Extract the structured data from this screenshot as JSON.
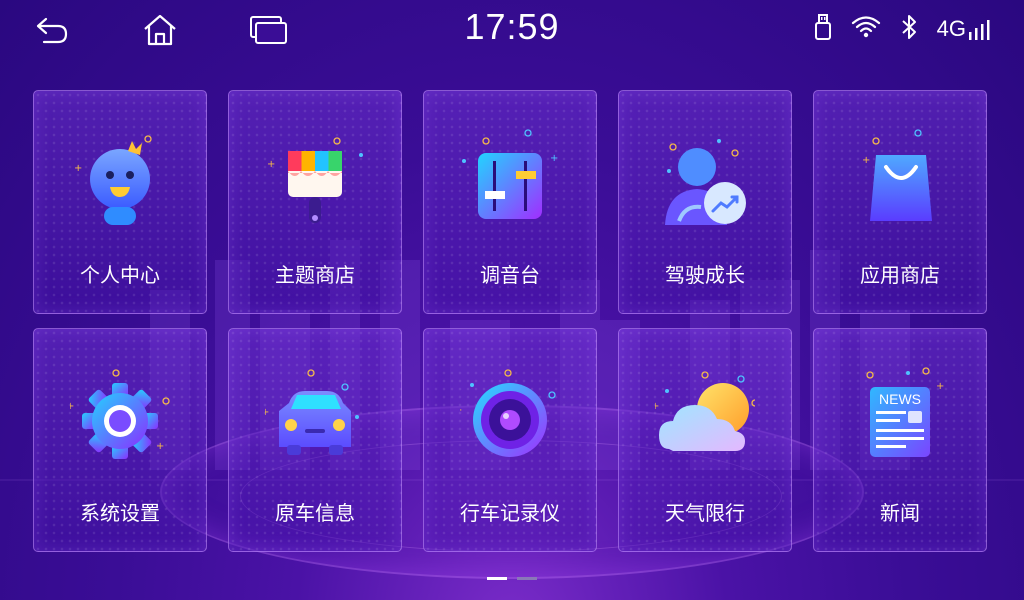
{
  "status": {
    "time": "17:59",
    "network": "4G"
  },
  "apps": [
    {
      "label": "个人中心",
      "icon": "avatar-icon"
    },
    {
      "label": "主题商店",
      "icon": "paintbrush-icon"
    },
    {
      "label": "调音台",
      "icon": "equalizer-icon"
    },
    {
      "label": "驾驶成长",
      "icon": "driver-growth-icon"
    },
    {
      "label": "应用商店",
      "icon": "shopping-bag-icon"
    },
    {
      "label": "系统设置",
      "icon": "gear-icon"
    },
    {
      "label": "原车信息",
      "icon": "car-icon"
    },
    {
      "label": "行车记录仪",
      "icon": "dashcam-icon"
    },
    {
      "label": "天气限行",
      "icon": "weather-icon"
    },
    {
      "label": "新闻",
      "icon": "news-icon",
      "badge_text": "NEWS"
    }
  ],
  "pager": {
    "pages": 2,
    "current": 1
  },
  "colors": {
    "background": "#3a0d96",
    "accent": "#f5b94a"
  }
}
